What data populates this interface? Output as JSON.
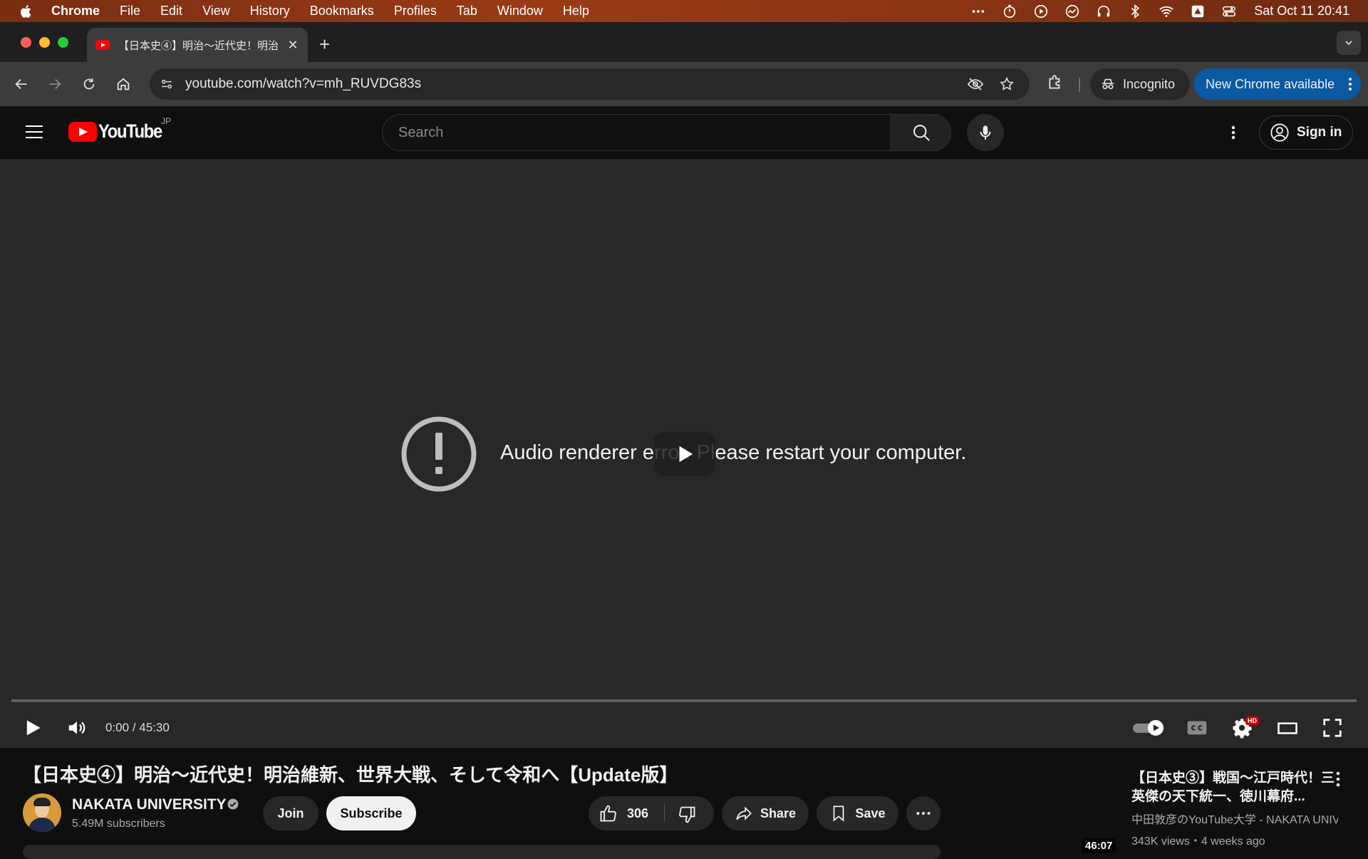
{
  "menubar": {
    "app_name": "Chrome",
    "items": [
      "File",
      "Edit",
      "View",
      "History",
      "Bookmarks",
      "Profiles",
      "Tab",
      "Window",
      "Help"
    ],
    "clock": "Sat Oct 11  20:41"
  },
  "browser": {
    "tab_title": "【日本史④】明治〜近代史！明治",
    "url": "youtube.com/watch?v=mh_RUVDG83s",
    "incognito_label": "Incognito",
    "update_label": "New Chrome available"
  },
  "youtube": {
    "logo_text": "YouTube",
    "region": "JP",
    "search_placeholder": "Search",
    "signin_label": "Sign in"
  },
  "player": {
    "error_message": "Audio renderer error. Please restart your computer.",
    "time_current": "0:00",
    "time_separator": " / ",
    "time_total": "45:30",
    "quality_badge": "HD"
  },
  "video": {
    "title": "【日本史④】明治〜近代史！明治維新、世界大戦、そして令和へ【Update版】",
    "channel_name": "NAKATA UNIVERSITY",
    "subscribers": "5.49M subscribers",
    "join_label": "Join",
    "subscribe_label": "Subscribe",
    "like_count": "306",
    "share_label": "Share",
    "save_label": "Save"
  },
  "recommendation": {
    "title": "【日本史③】戦国〜江戸時代！三英傑の天下統一、徳川幕府...",
    "channel": "中田敦彦のYouTube大学 - NAKATA UNIV...",
    "meta": "343K views・4 weeks ago",
    "duration": "46:07"
  },
  "colors": {
    "youtube_red": "#ff0000",
    "chrome_update_blue": "#0b5aa1",
    "player_bg": "#282828"
  }
}
